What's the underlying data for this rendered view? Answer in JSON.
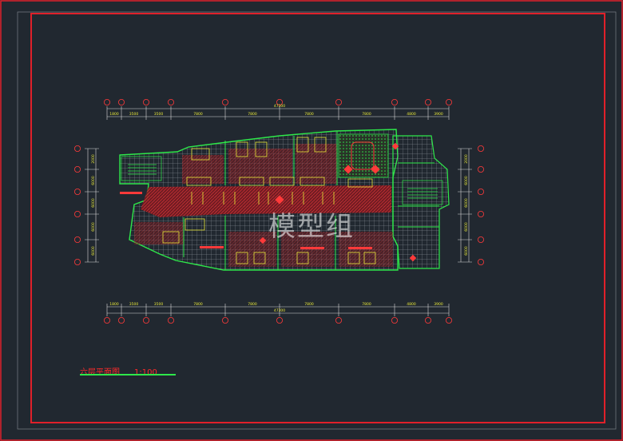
{
  "drawing": {
    "title": "六层平面图",
    "scale": "1:100",
    "watermark": "模型组"
  },
  "dimensions": {
    "overall_top": "47300",
    "overall_bottom": "47300",
    "segments_top": [
      "1800",
      "3500",
      "3500",
      "7800",
      "7800",
      "7800",
      "7800",
      "4800",
      "3900"
    ],
    "segments_bottom": [
      "1800",
      "3500",
      "3500",
      "7800",
      "7800",
      "7800",
      "7800",
      "4800",
      "3900"
    ],
    "segments_left": [
      "2000",
      "6000",
      "6000",
      "6000",
      "6000"
    ],
    "segments_right": [
      "2000",
      "6000",
      "6000",
      "6000",
      "6000"
    ]
  },
  "colors": {
    "background": "#212830",
    "border": "#e0202a",
    "walls": "#2ee84a",
    "furniture": "#e8e83a",
    "hatch": "#ff2a2a",
    "grid": "#c8c8c8",
    "dim": "#d8d8d8"
  }
}
